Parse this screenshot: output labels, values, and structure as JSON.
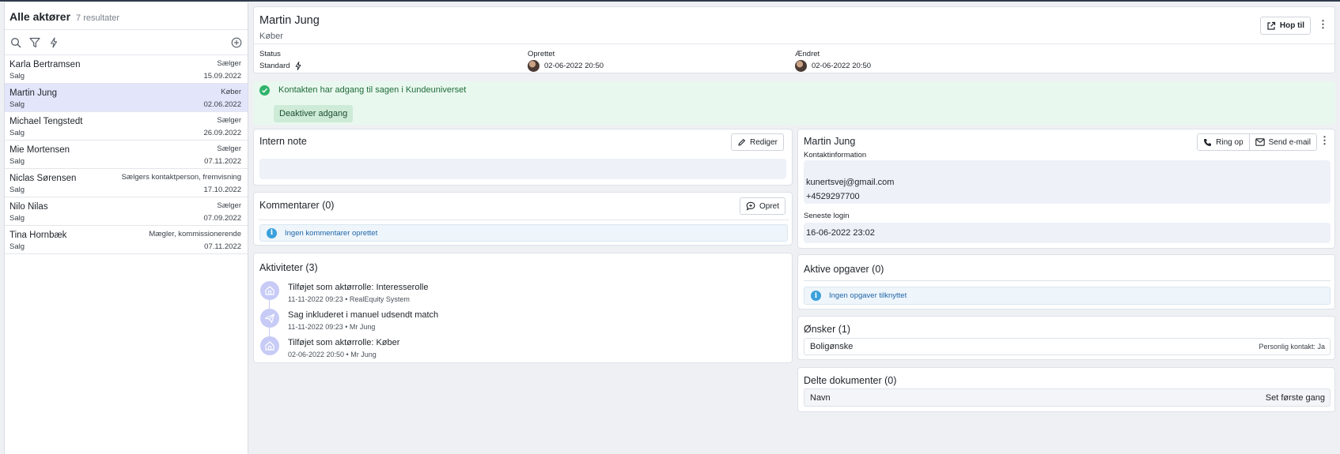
{
  "sidebar": {
    "title": "Alle aktører",
    "count": "7 resultater",
    "tools": [
      "search-icon",
      "filter-icon",
      "lightning-icon",
      "add-circle-icon"
    ],
    "actors": [
      {
        "name": "Karla Bertramsen",
        "role": "Sælger",
        "department": "Salg",
        "date": "15.09.2022",
        "selected": false
      },
      {
        "name": "Martin Jung",
        "role": "Køber",
        "department": "Salg",
        "date": "02.06.2022",
        "selected": true
      },
      {
        "name": "Michael Tengstedt",
        "role": "Sælger",
        "department": "Salg",
        "date": "26.09.2022",
        "selected": false
      },
      {
        "name": "Mie Mortensen",
        "role": "Sælger",
        "department": "Salg",
        "date": "07.11.2022",
        "selected": false
      },
      {
        "name": "Niclas Sørensen",
        "role": "Sælgers kontaktperson, fremvisning",
        "department": "Salg",
        "date": "17.10.2022",
        "selected": false
      },
      {
        "name": "Nilo Nilas",
        "role": "Sælger",
        "department": "Salg",
        "date": "07.09.2022",
        "selected": false
      },
      {
        "name": "Tina Hornbæk",
        "role": "Mægler, kommissionerende",
        "department": "Salg",
        "date": "07.11.2022",
        "selected": false
      }
    ]
  },
  "header": {
    "name": "Martin Jung",
    "role": "Køber",
    "jump_label": "Hop til",
    "status_label": "Status",
    "status_value": "Standard",
    "created_label": "Oprettet",
    "created_value": "02-06-2022 20:50",
    "changed_label": "Ændret",
    "changed_value": "02-06-2022 20:50"
  },
  "access": {
    "message": "Kontakten har adgang til sagen i Kundeuniverset",
    "button": "Deaktiver adgang"
  },
  "note": {
    "title": "Intern note",
    "edit_label": "Rediger"
  },
  "comments": {
    "title": "Kommentarer (0)",
    "create_label": "Opret",
    "empty": "Ingen kommentarer oprettet"
  },
  "activities": {
    "title": "Aktiviteter (3)",
    "items": [
      {
        "icon": "house-icon",
        "title": "Tilføjet som aktørrolle: Interesserolle",
        "meta": "11-11-2022 09:23 • RealEquity System"
      },
      {
        "icon": "paper-plane-icon",
        "title": "Sag inkluderet i manuel udsendt match",
        "meta": "11-11-2022 09:23 • Mr Jung"
      },
      {
        "icon": "house-icon",
        "title": "Tilføjet som aktørrolle: Køber",
        "meta": "02-06-2022 20:50 • Mr Jung"
      }
    ]
  },
  "contact": {
    "name": "Martin Jung",
    "call_label": "Ring op",
    "email_label": "Send e-mail",
    "info_label": "Kontaktinformation",
    "email": "kunertsvej@gmail.com",
    "phone": "+4529297700",
    "last_login_label": "Seneste login",
    "last_login": "16-06-2022 23:02"
  },
  "tasks": {
    "title": "Aktive opgaver (0)",
    "empty": "Ingen opgaver tilknyttet"
  },
  "wishes": {
    "title": "Ønsker (1)",
    "item": "Boligønske",
    "item_meta": "Personlig kontakt: Ja"
  },
  "documents": {
    "title": "Delte dokumenter (0)",
    "col_name": "Navn",
    "col_seen": "Set første gang"
  },
  "colors": {
    "selected_row": "#e3e6fb",
    "access_bg": "#e9f8ee",
    "access_text": "#1f6b3a",
    "info_text": "#2166a8",
    "activity_icon": "#c7cbf6"
  }
}
